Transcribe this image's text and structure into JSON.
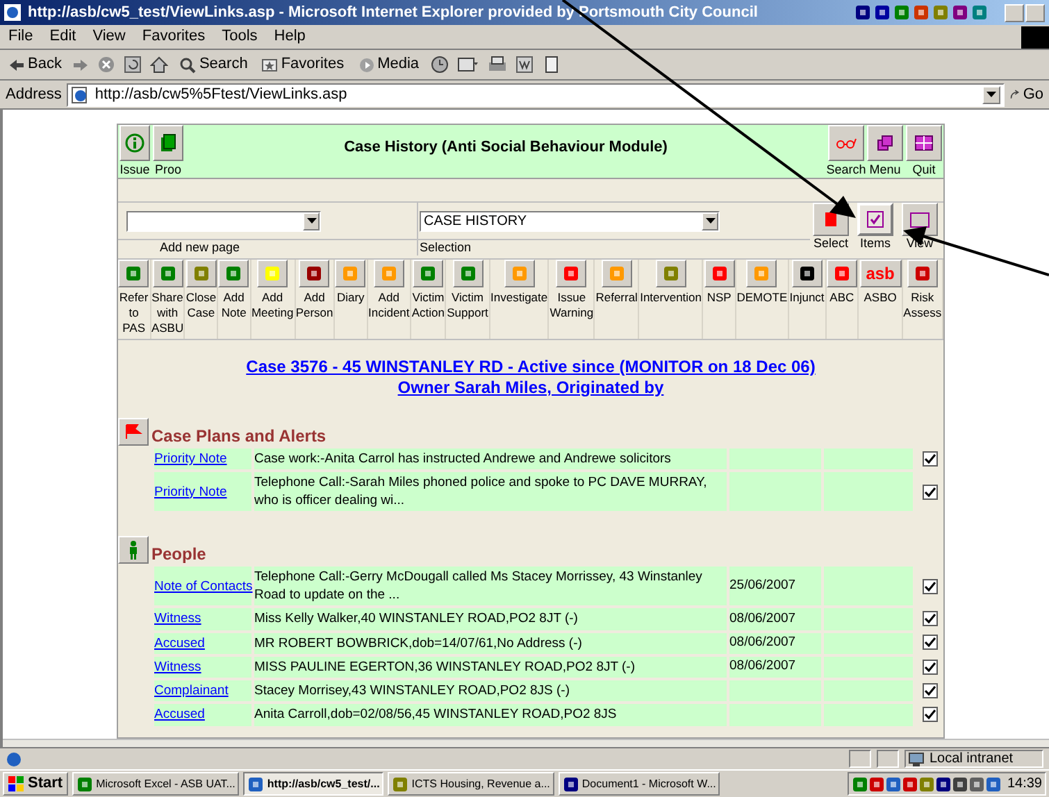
{
  "window": {
    "title": "http://asb/cw5_test/ViewLinks.asp - Microsoft Internet Explorer provided by Portsmouth City Council"
  },
  "menu": [
    "File",
    "Edit",
    "View",
    "Favorites",
    "Tools",
    "Help"
  ],
  "toolbar": [
    {
      "kind": "back",
      "label": "Back"
    },
    {
      "kind": "search",
      "label": "Search"
    },
    {
      "kind": "favorites",
      "label": "Favorites"
    },
    {
      "kind": "media",
      "label": "Media"
    }
  ],
  "address": {
    "label": "Address",
    "value": "http://asb/cw5%5Ftest/ViewLinks.asp",
    "go": "Go"
  },
  "app": {
    "title": "Case History (Anti Social Behaviour Module)",
    "left_buttons": [
      {
        "label": "Issue"
      },
      {
        "label": "Proo"
      }
    ],
    "right_buttons": [
      {
        "label": "Search"
      },
      {
        "label": "Menu"
      },
      {
        "label": "Quit"
      }
    ],
    "add_page": {
      "label": "Add new page"
    },
    "selection": {
      "label": "Selection",
      "value": "CASE HISTORY"
    },
    "view_buttons": [
      {
        "label": "Select",
        "selected": false
      },
      {
        "label": "Items",
        "selected": true
      },
      {
        "label": "View",
        "selected": false
      }
    ],
    "actions": [
      {
        "label": "Refer to PAS"
      },
      {
        "label": "Share with ASBU"
      },
      {
        "label": "Close Case"
      },
      {
        "label": "Add Note"
      },
      {
        "label": "Add Meeting"
      },
      {
        "label": "Add Person"
      },
      {
        "label": "Diary"
      },
      {
        "label": "Add Incident"
      },
      {
        "label": "Victim Action"
      },
      {
        "label": "Victim Support"
      },
      {
        "label": "Investigate"
      },
      {
        "label": "Issue Warning"
      },
      {
        "label": "Referral"
      },
      {
        "label": "Intervention"
      },
      {
        "label": "NSP"
      },
      {
        "label": "DEMOTE"
      },
      {
        "label": "Injunct"
      },
      {
        "label": "ABC"
      },
      {
        "label": "ASBO",
        "icon_text": "asb"
      },
      {
        "label": "Risk Assess"
      }
    ],
    "case_title": [
      "Case 3576 - 45 WINSTANLEY RD - Active since (MONITOR on 18 Dec 06)",
      "Owner Sarah Miles, Originated by"
    ],
    "sections": [
      {
        "kind": "flag",
        "title": "Case Plans and Alerts",
        "rows": [
          {
            "type": "Priority Note",
            "text": "Case work:-Anita Carrol has instructed Andrewe and Andrewe solicitors",
            "checked": true
          },
          {
            "type": "Priority Note",
            "text": "Telephone Call:-Sarah Miles phoned police and spoke to PC DAVE MURRAY, who is officer dealing wi...",
            "checked": true
          }
        ]
      },
      {
        "kind": "person",
        "title": "People",
        "rows": [
          {
            "type": "Note of Contacts",
            "text": "Telephone Call:-Gerry McDougall called Ms Stacey Morrissey, 43 Winstanley Road to update on the ...",
            "date": "25/06/2007",
            "checked": true
          },
          {
            "type": "Witness",
            "text": "Miss Kelly Walker,40 WINSTANLEY ROAD,PO2 8JT (-)",
            "date": "08/06/2007",
            "checked": true
          },
          {
            "type": "Accused",
            "text": "MR ROBERT BOWBRICK,dob=14/07/61,No Address (-)",
            "date": "08/06/2007",
            "checked": true
          },
          {
            "type": "Witness",
            "text": "MISS PAULINE EGERTON,36 WINSTANLEY ROAD,PO2 8JT (-)",
            "date": "08/06/2007",
            "checked": true
          },
          {
            "type": "Complainant",
            "text": "Stacey Morrisey,43 WINSTANLEY ROAD,PO2 8JS (-)",
            "checked": true
          },
          {
            "type": "Accused",
            "text": "Anita Carroll,dob=02/08/56,45 WINSTANLEY ROAD,PO2 8JS",
            "checked": true
          }
        ]
      }
    ]
  },
  "status_bar": {
    "zone": "Local intranet"
  },
  "taskbar": {
    "start": "Start",
    "tasks": [
      {
        "label": "Microsoft Excel - ASB UAT...",
        "selected": false
      },
      {
        "label": "http://asb/cw5_test/...",
        "selected": true
      },
      {
        "label": "ICTS Housing, Revenue a...",
        "selected": false
      },
      {
        "label": "Document1 - Microsoft W...",
        "selected": false
      }
    ],
    "clock": "14:39"
  }
}
